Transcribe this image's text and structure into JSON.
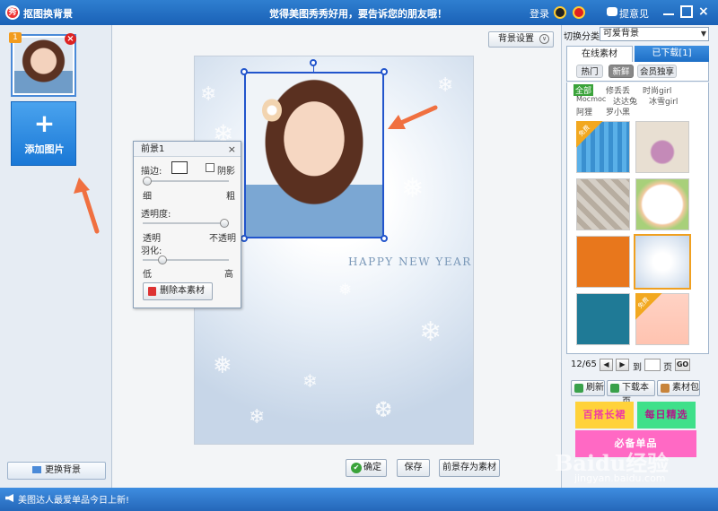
{
  "window": {
    "title": "抠图换背景",
    "slogan": "觉得美图秀秀好用，要告诉您的朋友哦！",
    "login": "登录",
    "feedback": "提意见",
    "close": "×"
  },
  "left_panel": {
    "thumb_badge": "1",
    "thumb_delete": "×",
    "add_plus": "+",
    "add_label": "添加图片",
    "change_bg": "更换背景"
  },
  "canvas": {
    "greeting": "HAPPY  NEW  YEAR",
    "settings_label": "背景设置",
    "settings_icon": "∨"
  },
  "fg_panel": {
    "title": "前景1",
    "close": "×",
    "stroke": "描边:",
    "shadow": "阴影",
    "thin": "细",
    "thick": "粗",
    "opacity": "透明度:",
    "transparent": "透明",
    "opaque": "不透明",
    "feather": "羽化:",
    "low": "低",
    "high": "高",
    "delete": "删除本素材",
    "opacity_value": 1.0,
    "feather_value": 0.2
  },
  "bottom_buttons": {
    "ok": "确定",
    "ok_icon": "✔",
    "save": "保存",
    "save_as_material": "前景存为素材"
  },
  "right_panel": {
    "category_label": "切换分类",
    "category_value": "可爱背景",
    "category_arrow": "▼",
    "tab_online": "在线素材",
    "tab_downloaded": "已下载[1]",
    "chips": {
      "hot": "热门",
      "new": "新鲜",
      "vip": "会员独享"
    },
    "filters": {
      "all": "全部",
      "f1": "修丢丢",
      "f2": "时尚girl",
      "f3": "Mocmoc",
      "f4": "达达兔",
      "f5": "冰雪girl",
      "f6": "阿狸",
      "f7": "罗小黑"
    },
    "free_tag": "免费",
    "pager": {
      "page": "12/65",
      "prev": "◀",
      "next": "▶",
      "go_to": "到",
      "unit": "页",
      "go": "GO"
    },
    "actions": {
      "refresh": "刷新",
      "download_page": "下载本页",
      "material_pack": "素材包"
    },
    "promos": {
      "p1": "百搭长裙",
      "p2": "每日精选",
      "p3": "必备单品"
    }
  },
  "status": {
    "text": "美图达人最爱单品今日上新!"
  },
  "watermark": {
    "text": "Baidu经验",
    "url": "jingyan.baidu.com"
  },
  "colors": {
    "titlebar": "#1a61b6",
    "accent_arrow": "#f07040",
    "selection": "#2255cc"
  }
}
